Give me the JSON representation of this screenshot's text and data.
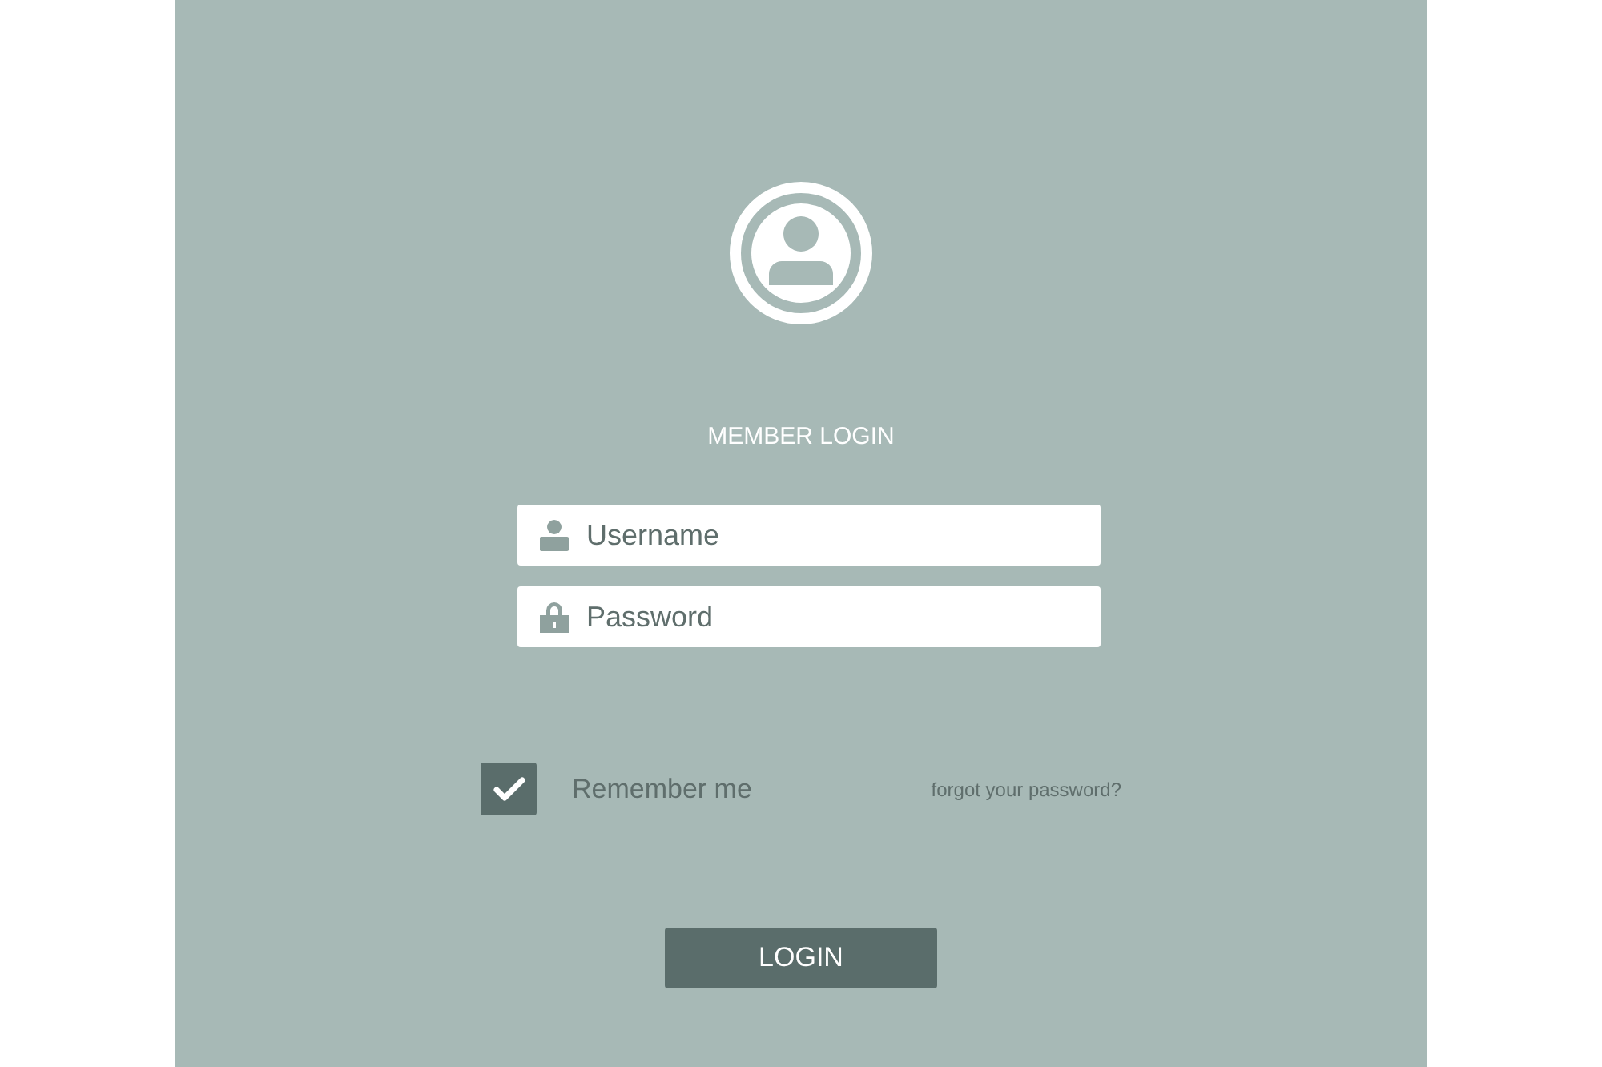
{
  "title": "MEMBER LOGIN",
  "fields": [
    {
      "kind": "user",
      "placeholder": "Username"
    },
    {
      "kind": "lock",
      "placeholder": "Password"
    }
  ],
  "remember": {
    "label": "Remember me",
    "checked": true
  },
  "forgot_link": "forgot your password?",
  "login_button": "LOGIN"
}
